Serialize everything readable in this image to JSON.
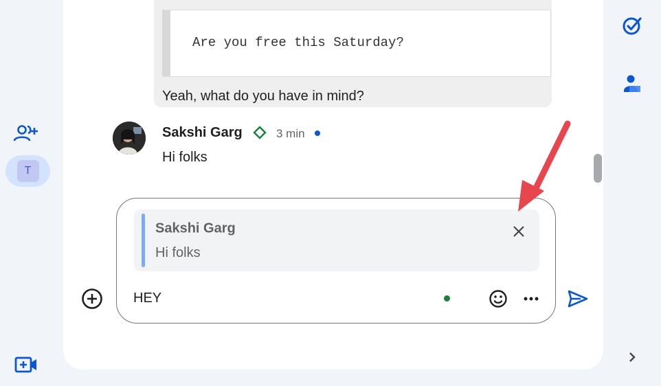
{
  "conversation": {
    "quoted_code": "Are you free this Saturday?",
    "reply_text": "Yeah, what do you have in mind?"
  },
  "message": {
    "sender": "Sakshi Garg",
    "time": "3 min",
    "text": "Hi folks"
  },
  "composer": {
    "reply_to_name": "Sakshi Garg",
    "reply_to_text": "Hi folks",
    "input_value": "HEY"
  },
  "sidebar": {
    "space_initial": "T"
  },
  "icons": {
    "add_people": "person-add-icon",
    "video": "video-add-icon",
    "tasks": "tasks-icon",
    "contacts": "contacts-icon",
    "expand": "chevron-right-icon",
    "close": "close-icon",
    "plus": "add-circle-icon",
    "emoji": "emoji-icon",
    "more": "more-horiz-icon",
    "send": "send-icon",
    "role": "diamond-icon"
  },
  "colors": {
    "accent": "#0b57d0",
    "annotation_arrow": "#e8464e",
    "role_badge": "#188038",
    "typing_dot": "#188038"
  }
}
